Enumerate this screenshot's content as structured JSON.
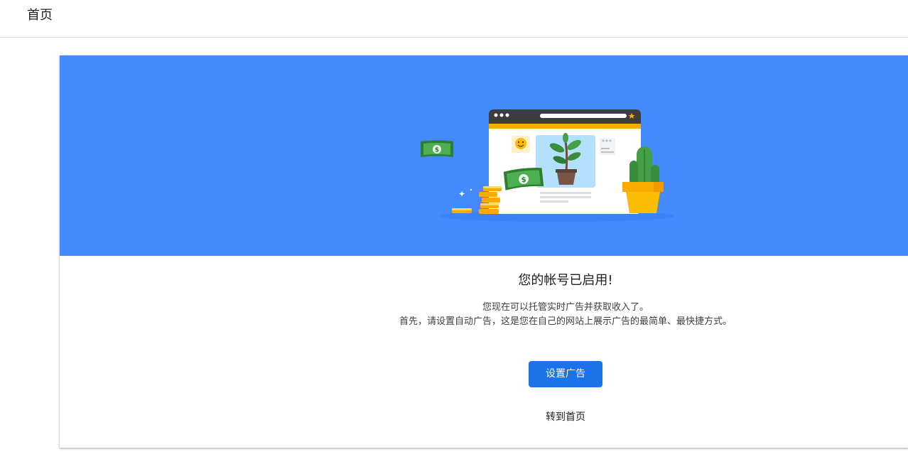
{
  "header": {
    "title": "首页"
  },
  "colors": {
    "hero_background": "#448aff",
    "primary_button": "#1a73e8"
  },
  "main": {
    "heading": "您的帐号已启用!",
    "description_line1": "您现在可以托管实时广告并获取收入了。",
    "description_line2": "首先，请设置自动广告，这是您在自己的网站上展示广告的最简单、最快捷方式。",
    "primary_button_label": "设置广告",
    "secondary_button_label": "转到首页"
  },
  "illustration": {
    "icons": [
      "browser-window-icon",
      "money-bill-icon",
      "coin-stack-icon",
      "cactus-icon",
      "plant-pot-icon",
      "smiley-icon"
    ]
  }
}
